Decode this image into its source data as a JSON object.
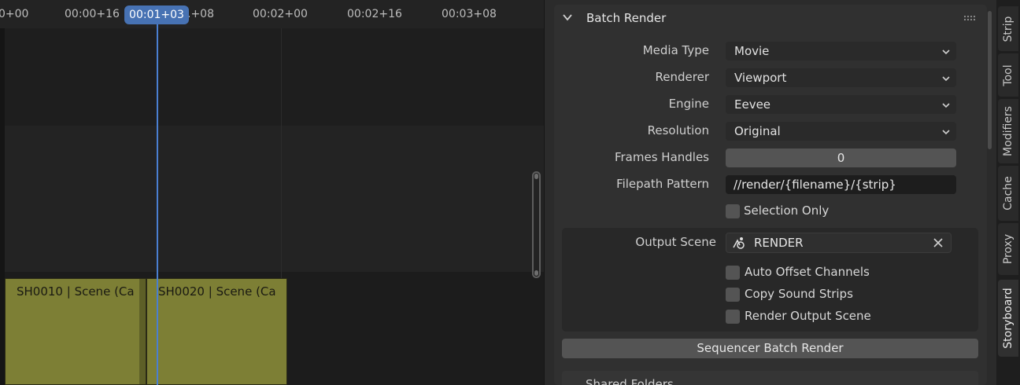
{
  "timeline": {
    "ticks": [
      "0+00",
      "00:00+16",
      "00:01+03",
      "00:02+00",
      "00:02+16",
      "00:03+08"
    ],
    "partial_tick": ".+08",
    "current_frame": "00:01+03",
    "strips": [
      {
        "label": "SH0010 | Scene (Ca"
      },
      {
        "label": "SH0020 | Scene (Ca"
      }
    ]
  },
  "panel": {
    "title": "Batch Render",
    "fields": {
      "media_type": {
        "label": "Media Type",
        "value": "Movie"
      },
      "renderer": {
        "label": "Renderer",
        "value": "Viewport"
      },
      "engine": {
        "label": "Engine",
        "value": "Eevee"
      },
      "resolution": {
        "label": "Resolution",
        "value": "Original"
      },
      "frame_handles": {
        "label": "Frames Handles",
        "value": "0"
      },
      "filepath": {
        "label": "Filepath Pattern",
        "value": "//render/{filename}/{strip}"
      }
    },
    "selection_only": {
      "label": "Selection Only",
      "checked": false
    },
    "output": {
      "label": "Output Scene",
      "value": "RENDER",
      "options": [
        {
          "label": "Auto Offset Channels",
          "checked": false
        },
        {
          "label": "Copy Sound Strips",
          "checked": false
        },
        {
          "label": "Render Output Scene",
          "checked": false
        }
      ]
    },
    "button": "Sequencer Batch Render",
    "next_panel": "Shared Folders"
  },
  "tabs": [
    "Strip",
    "Tool",
    "Modifiers",
    "Cache",
    "Proxy",
    "Storyboard"
  ],
  "active_tab": "Storyboard",
  "colors": {
    "playhead": "#4772b3",
    "strip": "#7d7f35",
    "panel": "#303030"
  }
}
